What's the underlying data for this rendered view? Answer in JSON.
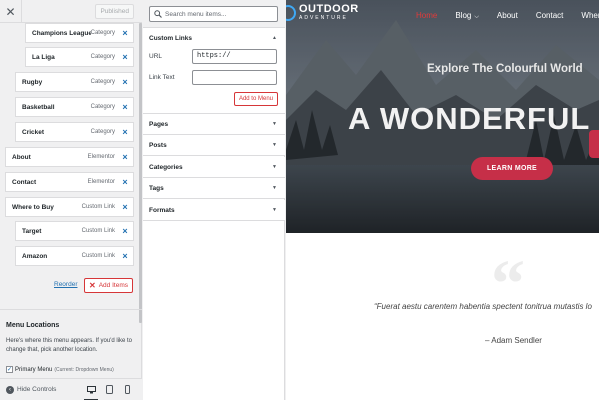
{
  "customizer": {
    "close_icon": "close-icon",
    "publish_button": "Published",
    "menu_items": [
      {
        "title": "Champions League",
        "type": "Category"
      },
      {
        "title": "La Liga",
        "type": "Category"
      },
      {
        "title": "Rugby",
        "type": "Category"
      },
      {
        "title": "Basketball",
        "type": "Category"
      },
      {
        "title": "Cricket",
        "type": "Category"
      },
      {
        "title": "About",
        "type": "Elementor"
      },
      {
        "title": "Contact",
        "type": "Elementor"
      },
      {
        "title": "Where to Buy",
        "type": "Custom Link"
      },
      {
        "title": "Target",
        "type": "Custom Link"
      },
      {
        "title": "Amazon",
        "type": "Custom Link"
      }
    ],
    "remove_icon": "×",
    "reorder_label": "Reorder",
    "add_items_label": "Add Items",
    "menu_locations": {
      "heading": "Menu Locations",
      "description": "Here's where this menu appears. If you'd like to change that, pick another location.",
      "primary_label": "Primary Menu",
      "primary_current": "(Current: Dropdown Menu)",
      "primary_checked": true
    },
    "footer": {
      "hide_controls_label": "Hide Controls",
      "active_device": "desktop"
    }
  },
  "add_panel": {
    "search_placeholder": "Search menu items...",
    "custom_links": {
      "title": "Custom Links",
      "url_label": "URL",
      "url_value": "https://",
      "link_text_label": "Link Text",
      "link_text_value": "",
      "add_button": "Add to Menu",
      "expanded": true
    },
    "sections": [
      "Pages",
      "Posts",
      "Categories",
      "Tags",
      "Formats"
    ]
  },
  "preview": {
    "logo_title": "OUTDOOR",
    "logo_subtitle": "ADVENTURE",
    "nav": [
      "Home",
      "Blog",
      "About",
      "Contact",
      "Where to"
    ],
    "hero_subtitle": "Explore The Colourful World",
    "hero_title": "A WONDERFUL",
    "cta_label": "LEARN MORE",
    "quote_mark": "“",
    "quote": "“Fuerat aestu carentem habentia spectent tonitrua mutastis lo",
    "author": "– Adam Sendler",
    "colors": {
      "accent": "#c62f48",
      "nav_active": "#e23a3a",
      "logo_ring": "#3fa9f5"
    }
  }
}
